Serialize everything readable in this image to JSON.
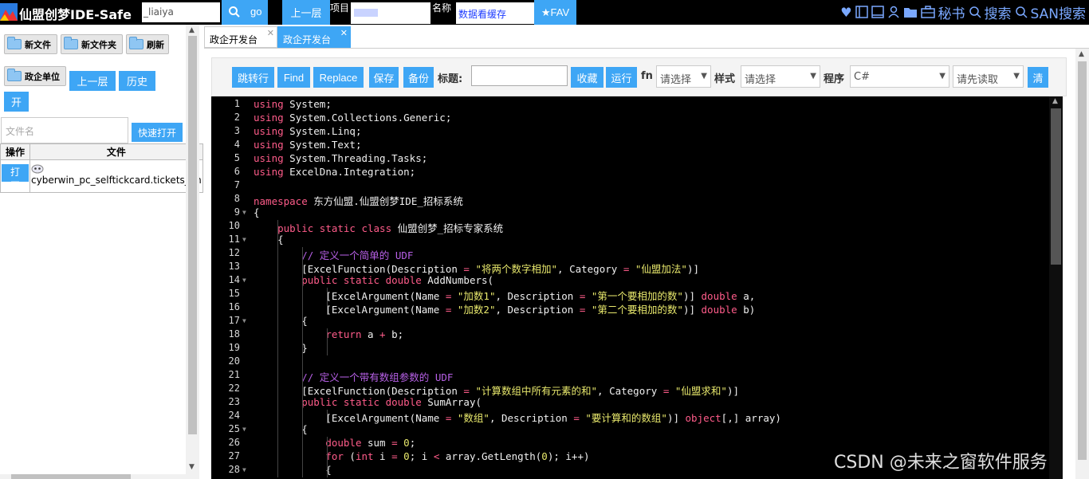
{
  "topbar": {
    "brand": "仙盟创梦IDE-Safe",
    "user_value": "_liaiya",
    "go_label": "go",
    "up_label": "上一层",
    "project_label": "项目",
    "name_label": "名称",
    "name_value": "数据看缓存",
    "fav_label": "★FAV",
    "secret_label": "秘书",
    "search_label": "搜索",
    "san_search_label": "SAN搜索"
  },
  "left": {
    "new_file": "新文件",
    "new_folder": "新文件夹",
    "refresh": "刷新",
    "gov_unit": "政企单位",
    "up_level": "上一层",
    "history": "历史",
    "open": "开",
    "filename_placeholder": "文件名",
    "quick_open": "快速打开",
    "table_headers": [
      "操作",
      "文件"
    ],
    "rows": [
      {
        "action": "打开",
        "file": "cyberwin_pc_selftickcard.tickets_on"
      }
    ]
  },
  "tabs": [
    {
      "label": "政企开发台",
      "active": false
    },
    {
      "label": "政企开发台",
      "active": true
    }
  ],
  "toolbar": {
    "jump": "跳转行",
    "find": "Find",
    "replace": "Replace",
    "save": "保存",
    "backup": "备份",
    "title_label": "标题:",
    "collect": "收藏",
    "run": "运行",
    "fn_label": "fn",
    "fn_select": "请选择",
    "style_label": "样式",
    "style_select": "请选择",
    "program_label": "程序",
    "program_select": "C#",
    "read_select": "请先读取",
    "clear": "清"
  },
  "editor": {
    "lines": [
      [
        [
          "kw",
          "using"
        ],
        [
          "t",
          " System;"
        ]
      ],
      [
        [
          "kw",
          "using"
        ],
        [
          "t",
          " System.Collections.Generic;"
        ]
      ],
      [
        [
          "kw",
          "using"
        ],
        [
          "t",
          " System.Linq;"
        ]
      ],
      [
        [
          "kw",
          "using"
        ],
        [
          "t",
          " System.Text;"
        ]
      ],
      [
        [
          "kw",
          "using"
        ],
        [
          "t",
          " System.Threading.Tasks;"
        ]
      ],
      [
        [
          "kw",
          "using"
        ],
        [
          "t",
          " ExcelDna.Integration;"
        ]
      ],
      [],
      [
        [
          "kw",
          "namespace"
        ],
        [
          "t",
          " 东方仙盟.仙盟创梦IDE_招标系统"
        ]
      ],
      [
        [
          "t",
          "{"
        ]
      ],
      [
        [
          "t",
          "    "
        ],
        [
          "kw",
          "public"
        ],
        [
          "t",
          " "
        ],
        [
          "kw",
          "static"
        ],
        [
          "t",
          " "
        ],
        [
          "kw",
          "class"
        ],
        [
          "t",
          " 仙盟创梦_招标专家系统"
        ]
      ],
      [
        [
          "t",
          "    {"
        ]
      ],
      [
        [
          "t",
          "        "
        ],
        [
          "cmt",
          "// 定义一个简单的 UDF"
        ]
      ],
      [
        [
          "t",
          "        [ExcelFunction(Description "
        ],
        [
          "op",
          "="
        ],
        [
          "t",
          " "
        ],
        [
          "str",
          "\"将两个数字相加\""
        ],
        [
          "t",
          ", Category "
        ],
        [
          "op",
          "="
        ],
        [
          "t",
          " "
        ],
        [
          "str",
          "\"仙盟加法\""
        ],
        [
          "t",
          ")]"
        ]
      ],
      [
        [
          "t",
          "        "
        ],
        [
          "kw",
          "public"
        ],
        [
          "t",
          " "
        ],
        [
          "kw",
          "static"
        ],
        [
          "t",
          " "
        ],
        [
          "kw",
          "double"
        ],
        [
          "t",
          " AddNumbers("
        ]
      ],
      [
        [
          "t",
          "            [ExcelArgument(Name "
        ],
        [
          "op",
          "="
        ],
        [
          "t",
          " "
        ],
        [
          "str",
          "\"加数1\""
        ],
        [
          "t",
          ", Description "
        ],
        [
          "op",
          "="
        ],
        [
          "t",
          " "
        ],
        [
          "str",
          "\"第一个要相加的数\""
        ],
        [
          "t",
          ")] "
        ],
        [
          "kw",
          "double"
        ],
        [
          "t",
          " a,"
        ]
      ],
      [
        [
          "t",
          "            [ExcelArgument(Name "
        ],
        [
          "op",
          "="
        ],
        [
          "t",
          " "
        ],
        [
          "str",
          "\"加数2\""
        ],
        [
          "t",
          ", Description "
        ],
        [
          "op",
          "="
        ],
        [
          "t",
          " "
        ],
        [
          "str",
          "\"第二个要相加的数\""
        ],
        [
          "t",
          ")] "
        ],
        [
          "kw",
          "double"
        ],
        [
          "t",
          " b)"
        ]
      ],
      [
        [
          "t",
          "        {"
        ]
      ],
      [
        [
          "t",
          "            "
        ],
        [
          "kw",
          "return"
        ],
        [
          "t",
          " a "
        ],
        [
          "op",
          "+"
        ],
        [
          "t",
          " b;"
        ]
      ],
      [
        [
          "t",
          "        }"
        ]
      ],
      [],
      [
        [
          "t",
          "        "
        ],
        [
          "cmt",
          "// 定义一个带有数组参数的 UDF"
        ]
      ],
      [
        [
          "t",
          "        [ExcelFunction(Description "
        ],
        [
          "op",
          "="
        ],
        [
          "t",
          " "
        ],
        [
          "str",
          "\"计算数组中所有元素的和\""
        ],
        [
          "t",
          ", Category "
        ],
        [
          "op",
          "="
        ],
        [
          "t",
          " "
        ],
        [
          "str",
          "\"仙盟求和\""
        ],
        [
          "t",
          ")]"
        ]
      ],
      [
        [
          "t",
          "        "
        ],
        [
          "kw",
          "public"
        ],
        [
          "t",
          " "
        ],
        [
          "kw",
          "static"
        ],
        [
          "t",
          " "
        ],
        [
          "kw",
          "double"
        ],
        [
          "t",
          " SumArray("
        ]
      ],
      [
        [
          "t",
          "            [ExcelArgument(Name "
        ],
        [
          "op",
          "="
        ],
        [
          "t",
          " "
        ],
        [
          "str",
          "\"数组\""
        ],
        [
          "t",
          ", Description "
        ],
        [
          "op",
          "="
        ],
        [
          "t",
          " "
        ],
        [
          "str",
          "\"要计算和的数组\""
        ],
        [
          "t",
          ")] "
        ],
        [
          "kw",
          "object"
        ],
        [
          "t",
          "[,] array)"
        ]
      ],
      [
        [
          "t",
          "        {"
        ]
      ],
      [
        [
          "t",
          "            "
        ],
        [
          "kw",
          "double"
        ],
        [
          "t",
          " sum "
        ],
        [
          "op",
          "="
        ],
        [
          "t",
          " "
        ],
        [
          "str",
          "0"
        ],
        [
          "t",
          ";"
        ]
      ],
      [
        [
          "t",
          "            "
        ],
        [
          "kw",
          "for"
        ],
        [
          "t",
          " ("
        ],
        [
          "kw",
          "int"
        ],
        [
          "t",
          " i "
        ],
        [
          "op",
          "="
        ],
        [
          "t",
          " "
        ],
        [
          "str",
          "0"
        ],
        [
          "t",
          "; i "
        ],
        [
          "op",
          "<"
        ],
        [
          "t",
          " array.GetLength("
        ],
        [
          "str",
          "0"
        ],
        [
          "t",
          "); i++)"
        ]
      ],
      [
        [
          "t",
          "            {"
        ]
      ]
    ],
    "line_numbers": [
      "1",
      "2",
      "3",
      "4",
      "5",
      "6",
      "7",
      "8",
      "9",
      "10",
      "11",
      "12",
      "13",
      "14",
      "15",
      "16",
      "17",
      "18",
      "19",
      "20",
      "21",
      "22",
      "23",
      "24",
      "25",
      "26",
      "27",
      "28"
    ],
    "fold_lines": [
      9,
      11,
      14,
      17,
      25,
      28
    ]
  },
  "watermark": "CSDN @未来之窗软件服务"
}
